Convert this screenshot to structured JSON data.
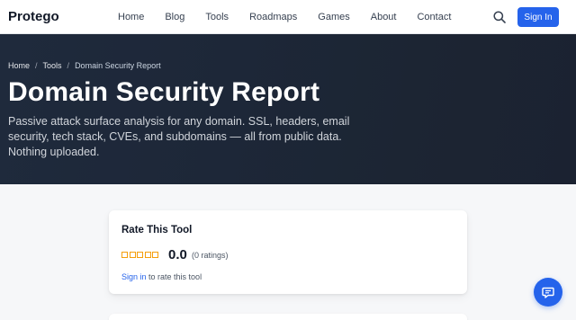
{
  "brand": {
    "name": "Protego",
    "accent": "#2563eb"
  },
  "nav": {
    "links": [
      "Home",
      "Blog",
      "Tools",
      "Roadmaps",
      "Games",
      "About",
      "Contact"
    ],
    "search_icon": "search-icon",
    "signin_label": "Sign In"
  },
  "hero": {
    "breadcrumb": {
      "home": "Home",
      "tools": "Tools",
      "current": "Domain Security Report",
      "separator": "/"
    },
    "title": "Domain Security Report",
    "description": "Passive attack surface analysis for any domain. SSL, headers, email security, tech stack, CVEs, and subdomains — all from public data. Nothing uploaded."
  },
  "rating": {
    "title": "Rate This Tool",
    "stars_filled": 0,
    "stars_total": 5,
    "score": "0.0",
    "count_text": "(0 ratings)",
    "signin_link": "Sign in",
    "signin_suffix": " to rate this tool"
  },
  "fab": {
    "icon": "chat-icon"
  }
}
